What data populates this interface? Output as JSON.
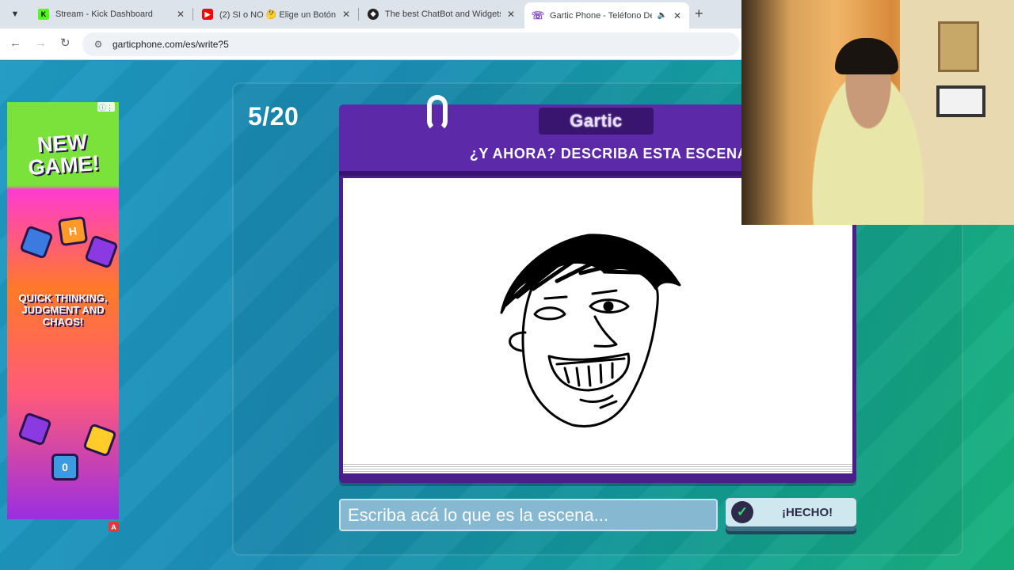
{
  "browser": {
    "tabs": [
      {
        "title": "Stream - Kick Dashboard",
        "favicon": "kick-icon",
        "color": "#53fc18",
        "active": false
      },
      {
        "title": "(2) SI o NO 🤔 Elige un Botón",
        "favicon": "youtube-icon",
        "color": "#ff0000",
        "active": false
      },
      {
        "title": "The best ChatBot and Widgets",
        "favicon": "chatbot-icon",
        "color": "#222222",
        "active": false
      },
      {
        "title": "Gartic Phone - Teléfono Des",
        "favicon": "gartic-icon",
        "color": "#7b3fbf",
        "active": true
      }
    ],
    "url": "garticphone.com/es/write?5"
  },
  "ad": {
    "headline": "NEW GAME!",
    "tagline": "QUICK THINKING, JUDGMENT AND CHAOS!",
    "tiles": [
      "H",
      "0"
    ]
  },
  "game": {
    "round": "5/20",
    "logo": "Gartic",
    "prompt": "¿Y AHORA? DESCRIBA ESTA ESCENA",
    "input_placeholder": "Escriba acá lo que es la escena...",
    "done_label": "¡HECHO!"
  },
  "colors": {
    "card": "#4b1f8a",
    "header": "#5c2aa8",
    "accent_check": "#35d67a"
  }
}
